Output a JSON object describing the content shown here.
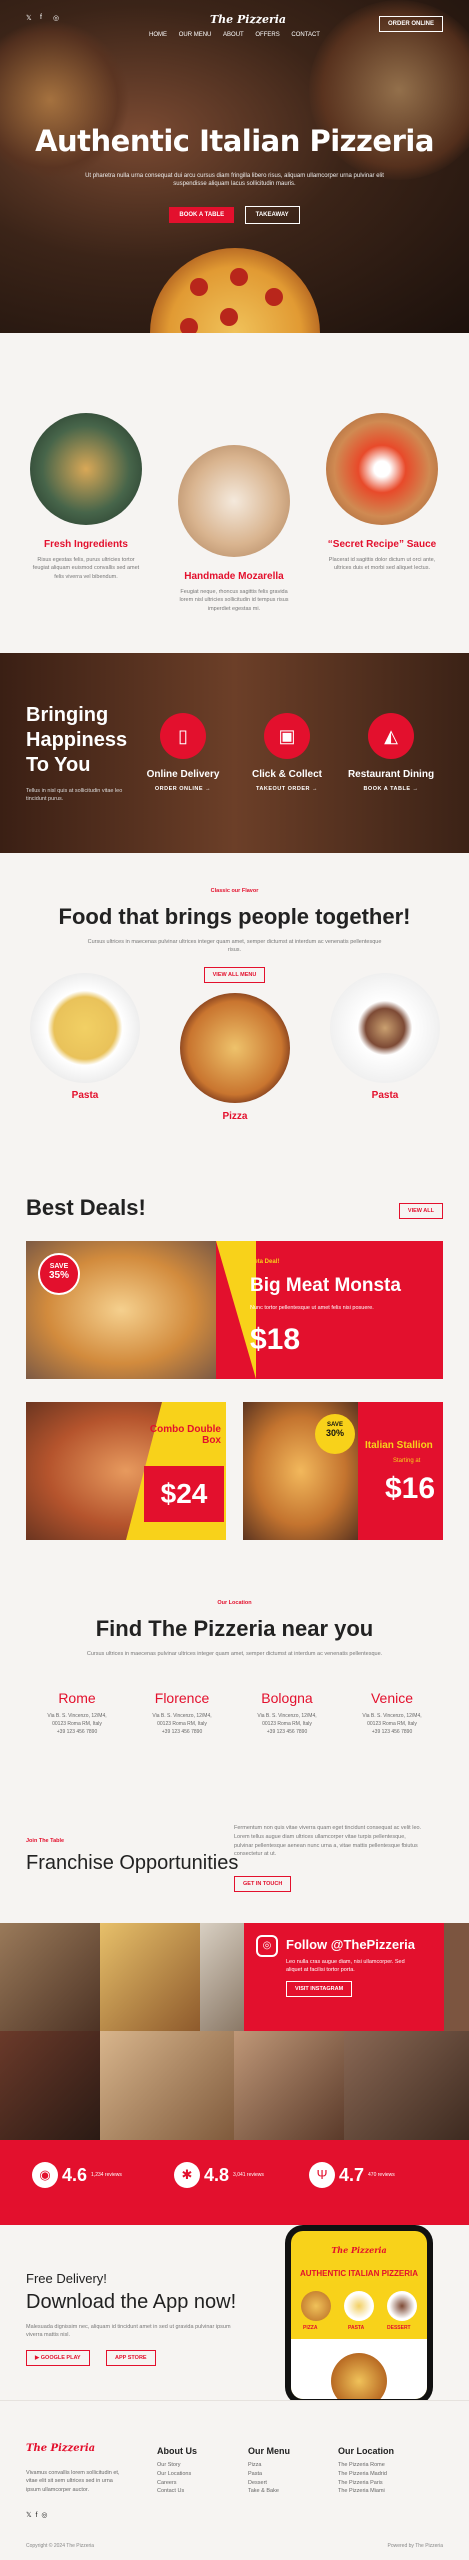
{
  "header": {
    "brand": "The Pizzeria",
    "nav": [
      "HOME",
      "OUR MENU",
      "ABOUT",
      "OFFERS",
      "CONTACT"
    ],
    "order_btn": "ORDER ONLINE",
    "social": [
      "twitter-icon",
      "facebook-icon",
      "instagram-icon"
    ]
  },
  "hero": {
    "title": "Authentic Italian Pizzeria",
    "subtitle": "Ut pharetra nulla urna consequat dui arcu cursus diam fringilla libero risus, aliquam ullamcorper urna pulvinar elit suspendisse aliquam lacus sollicitudin mauris.",
    "btn_book": "BOOK A TABLE",
    "btn_takeaway": "TAKEAWAY"
  },
  "features": [
    {
      "title": "Fresh Ingredients",
      "text": "Risus egestas felis, purus ultricies tortor feugiat aliquam euismod convallis sed amet felis viverra vel bibendum."
    },
    {
      "title": "Handmade Mozarella",
      "text": "Feugiat neque, rhoncus sagittis felis gravida lorem nisl ultricies sollicitudin id tempus risus imperdiet egestas mi."
    },
    {
      "title": "“Secret Recipe” Sauce",
      "text": "Placerat id sagittis dolor dictum ut orci ante, ultrices duis et morbi sed aliquet lectus."
    }
  ],
  "happiness": {
    "title_lines": [
      "Bringing",
      "Happiness",
      "To You"
    ],
    "text": "Tellus in nisl quis at sollicitudin vitae leo tincidunt purus.",
    "services": [
      {
        "title": "Online Delivery",
        "link": "ORDER ONLINE →"
      },
      {
        "title": "Click & Collect",
        "link": "TAKEOUT ORDER →"
      },
      {
        "title": "Restaurant Dining",
        "link": "BOOK A TABLE →"
      }
    ]
  },
  "food": {
    "kicker": "Classic our Flavor",
    "title": "Food that brings people together!",
    "text": "Cursus ultrices in maecenas pulvinar ultrices integer quam amet, semper dictumst at interdum ac venenatis pellentesque risus.",
    "btn": "VIEW ALL MENU",
    "items": [
      "Pasta",
      "Pizza",
      "Pasta"
    ]
  },
  "deals": {
    "title": "Best Deals!",
    "view_all": "VIEW ALL",
    "main": {
      "badge_save": "SAVE",
      "badge_pct": "35%",
      "kicker": "Beta Deal!",
      "name": "Big Meat Monsta",
      "text": "Nunc tortor pellentesque ut amet felis nisi posuere.",
      "price": "$18"
    },
    "combo": {
      "name": "Combo Double Box",
      "price": "$24"
    },
    "stallion": {
      "badge_save": "SAVE",
      "badge_pct": "30%",
      "name": "Italian Stallion",
      "starting": "Starting at",
      "price": "$16"
    }
  },
  "locations": {
    "kicker": "Our Location",
    "title": "Find The Pizzeria near you",
    "text": "Cursus ultrices in maecenas pulvinar ultrices integer quam amet, semper dictumst at interdum ac venenatis pellentesque.",
    "cities": [
      {
        "name": "Rome",
        "addr": "Via B. S. Vincenzo, 12/M4,",
        "zip": "00123 Roma RM, Italy",
        "tel": "+39 123 456 7890"
      },
      {
        "name": "Florence",
        "addr": "Via B. S. Vincenzo, 12/M4,",
        "zip": "00123 Roma RM, Italy",
        "tel": "+39 123 456 7890"
      },
      {
        "name": "Bologna",
        "addr": "Via B. S. Vincenzo, 12/M4,",
        "zip": "00123 Roma RM, Italy",
        "tel": "+39 123 456 7890"
      },
      {
        "name": "Venice",
        "addr": "Via B. S. Vincenzo, 12/M4,",
        "zip": "00123 Roma RM, Italy",
        "tel": "+39 123 456 7890"
      }
    ]
  },
  "franchise": {
    "kicker": "Join The Table",
    "title": "Franchise Opportunities",
    "text": "Fermentum non quis vitae viverra quam eget tincidunt consequat ac velit leo. Lorem tellus augue diam ultrices ullamcorper vitae turpis pellentesque, pulvinar pellentesque aenean nunc urna a, vitae mattis pellentesque fbiutus consectetur at ut.",
    "btn": "GET IN TOUCH"
  },
  "gallery": {
    "title": "Follow @ThePizzeria",
    "text": "Leo nulla cras augue diam, nisi ullamcorper. Sed aliquet at facilisi tortor porta.",
    "btn": "VISIT INSTAGRAM"
  },
  "ratings": [
    {
      "value": "4.6",
      "label": "1,234 reviews"
    },
    {
      "value": "4.8",
      "label": "3,041 reviews"
    },
    {
      "value": "4.7",
      "label": "470 reviews"
    }
  ],
  "app": {
    "kicker": "Free Delivery!",
    "title": "Download the App now!",
    "text": "Malesuada dignissim nec, aliquam id tincidunt amet in sed ut gravida pulvinar ipsum viverra mattis nisl.",
    "btn_google": "GOOGLE PLAY",
    "btn_apple": "APP STORE",
    "phone_brand": "The Pizzeria",
    "phone_title": "AUTHENTIC ITALIAN PIZZERIA",
    "phone_items": [
      "PIZZA",
      "PASTA",
      "DESSERT"
    ]
  },
  "footer": {
    "brand": "The Pizzeria",
    "text": "Vivamus convallis lorem sollicitudin et, vitae elit sit sem ultrices sed in urna ipsum ullamcorper auctor.",
    "cols": [
      {
        "title": "About Us",
        "items": [
          "Our Story",
          "Our Locations",
          "Careers",
          "Contact Us"
        ]
      },
      {
        "title": "Our Menu",
        "items": [
          "Pizza",
          "Pasta",
          "Dessert",
          "Take & Bake"
        ]
      },
      {
        "title": "Our Location",
        "items": [
          "The Pizzeria Rome",
          "The Pizzeria Madrid",
          "The Pizzeria Paris",
          "The Pizzeria Miami"
        ]
      }
    ],
    "copyright": "Copyright © 2024 The Pizzeria",
    "powered": "Powered by The Pizzeria"
  }
}
